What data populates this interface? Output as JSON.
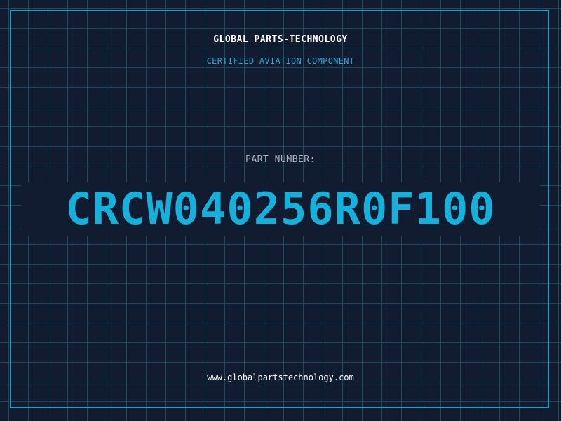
{
  "header": {
    "company_name": "GLOBAL PARTS-TECHNOLOGY",
    "subtitle": "CERTIFIED AVIATION COMPONENT"
  },
  "part": {
    "label": "PART NUMBER:",
    "number": "CRCW040256R0F100"
  },
  "footer": {
    "website": "www.globalpartstechnology.com"
  },
  "colors": {
    "background": "#121c30",
    "grid": "#1e4a5e",
    "accent": "#1f9bc7",
    "part_number": "#15b0dc",
    "label": "#a8b4c4"
  }
}
